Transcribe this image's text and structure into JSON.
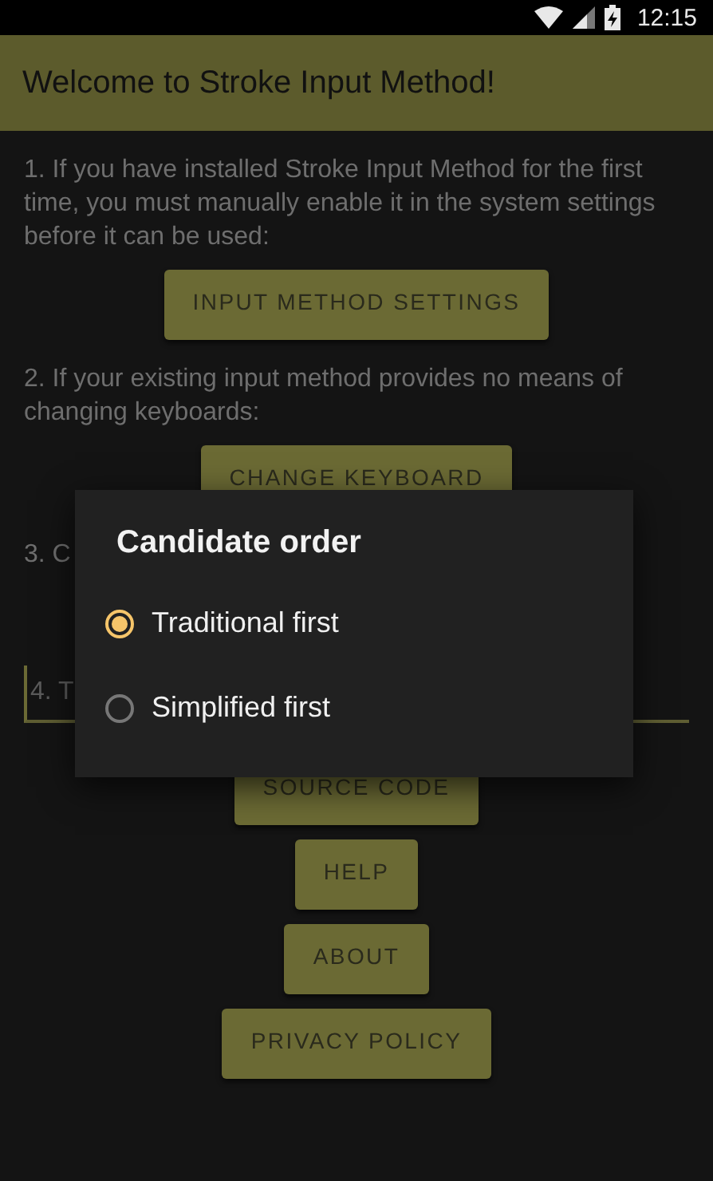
{
  "status_bar": {
    "time": "12:15"
  },
  "app_bar": {
    "title": "Welcome to Stroke Input Method!"
  },
  "steps": [
    {
      "text": "1. If you have installed Stroke Input Method for the first time, you must manually enable it in the system settings before it can be used:",
      "button": "INPUT METHOD SETTINGS"
    },
    {
      "text": "2. If your existing input method provides no means of changing keyboards:",
      "button": "CHANGE KEYBOARD"
    },
    {
      "text": "3. C"
    }
  ],
  "test_field": {
    "placeholder": "4. T"
  },
  "buttons": [
    "SOURCE CODE",
    "HELP",
    "ABOUT",
    "PRIVACY POLICY"
  ],
  "dialog": {
    "title": "Candidate order",
    "options": [
      {
        "label": "Traditional first",
        "selected": true
      },
      {
        "label": "Simplified first",
        "selected": false
      }
    ]
  }
}
